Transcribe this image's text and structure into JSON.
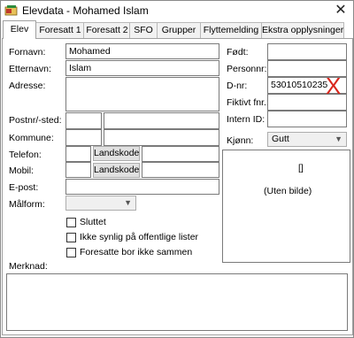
{
  "window": {
    "title": "Elevdata - Mohamed Islam",
    "close": "✕"
  },
  "tabs": [
    "Elev",
    "Foresatt 1",
    "Foresatt 2",
    "SFO",
    "Grupper",
    "Flyttemelding",
    "Ekstra opplysninger"
  ],
  "left": {
    "fornavn_label": "Fornavn:",
    "fornavn_value": "Mohamed",
    "etternavn_label": "Etternavn:",
    "etternavn_value": "Islam",
    "adresse_label": "Adresse:",
    "postnr_label": "Postnr/-sted:",
    "kommune_label": "Kommune:",
    "telefon_label": "Telefon:",
    "mobil_label": "Mobil:",
    "epost_label": "E-post:",
    "malform_label": "Målform:",
    "landskode_label": "Landskode"
  },
  "checkboxes": {
    "sluttet": "Sluttet",
    "ikke_synlig": "Ikke synlig på offentlige lister",
    "foresatte": "Foresatte bor ikke sammen"
  },
  "right": {
    "fodt_label": "Født:",
    "personnr_label": "Personnr:",
    "dnr_label": "D-nr:",
    "dnr_value": "53010510235",
    "fiktivt_label": "Fiktivt fnr.:",
    "internid_label": "Intern ID:",
    "kjonn_label": "Kjønn:",
    "kjonn_value": "Gutt",
    "photo_brackets": "[]",
    "photo_text": "(Uten bilde)"
  },
  "merknad_label": "Merknad:",
  "annotation": {
    "mark": "X",
    "color": "#d9261c"
  }
}
